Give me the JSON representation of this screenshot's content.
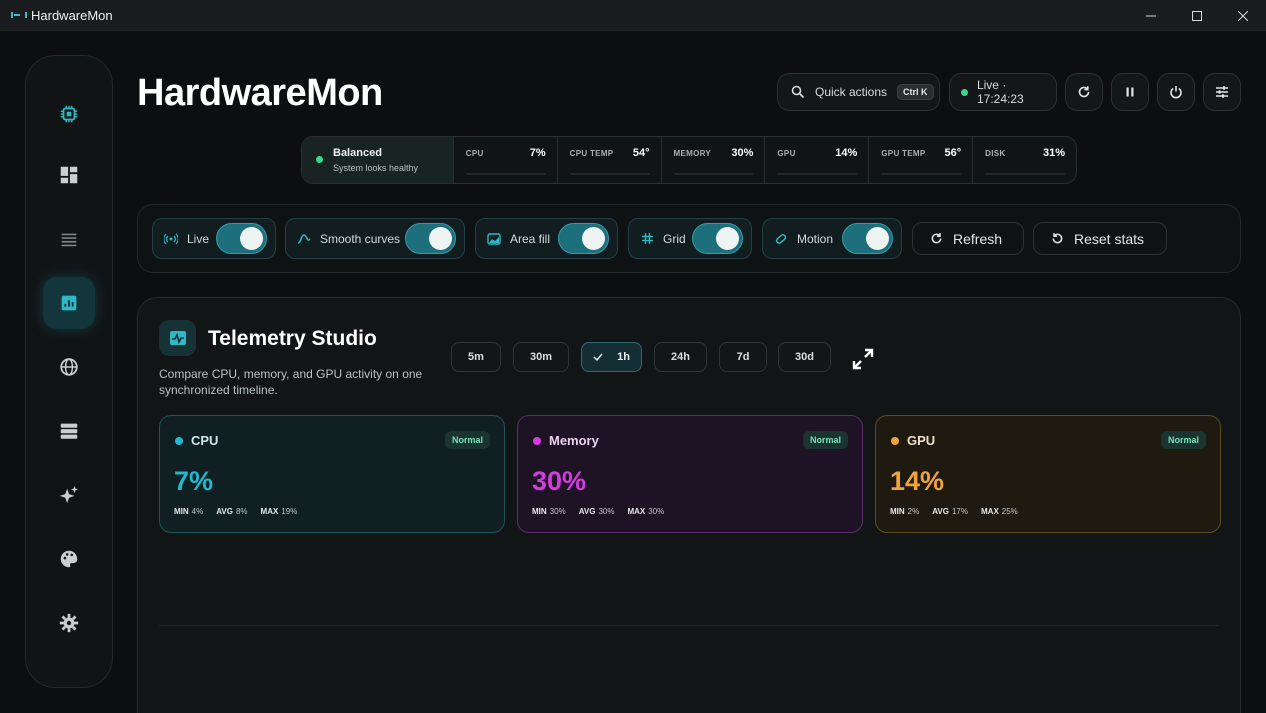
{
  "window": {
    "title": "HardwareMon",
    "minimize": "—",
    "maximize": "☐",
    "close": "✕"
  },
  "header": {
    "brand": "HardwareMon",
    "quick_actions": {
      "label": "Quick actions",
      "shortcut": "Ctrl K"
    },
    "live": {
      "text": "Live · 17:24:23",
      "color": "#3ed68f"
    }
  },
  "sidebar": {
    "items": [
      {
        "name": "chip-icon",
        "active": false
      },
      {
        "name": "dashboard-icon",
        "active": false
      },
      {
        "name": "list-icon",
        "active": false
      },
      {
        "name": "chart-icon",
        "active": true
      },
      {
        "name": "globe-icon",
        "active": false
      },
      {
        "name": "server-icon",
        "active": false
      },
      {
        "name": "sparkles-icon",
        "active": false
      },
      {
        "name": "palette-icon",
        "active": false
      },
      {
        "name": "gear-icon",
        "active": false
      }
    ]
  },
  "status": {
    "health": {
      "title": "Balanced",
      "subtitle": "System looks healthy"
    },
    "metrics": [
      {
        "label": "CPU",
        "value": "7%"
      },
      {
        "label": "CPU TEMP",
        "value": "54°"
      },
      {
        "label": "MEMORY",
        "value": "30%"
      },
      {
        "label": "GPU",
        "value": "14%"
      },
      {
        "label": "GPU TEMP",
        "value": "56°"
      },
      {
        "label": "DISK",
        "value": "31%"
      }
    ]
  },
  "toggles": [
    {
      "label": "Live",
      "on": true
    },
    {
      "label": "Smooth curves",
      "on": true
    },
    {
      "label": "Area fill",
      "on": true
    },
    {
      "label": "Grid",
      "on": true
    },
    {
      "label": "Motion",
      "on": true
    }
  ],
  "actions": {
    "refresh": "Refresh",
    "reset": "Reset stats"
  },
  "studio": {
    "title": "Telemetry Studio",
    "subtitle": "Compare CPU, memory, and GPU activity on one synchronized timeline.",
    "ranges": [
      "5m",
      "30m",
      "1h",
      "24h",
      "7d",
      "30d"
    ],
    "selected_range": "1h",
    "cards": [
      {
        "name": "CPU",
        "status": "Normal",
        "value": "7%",
        "color": "#22b8cf",
        "min": "4%",
        "avg": "8%",
        "max": "19%"
      },
      {
        "name": "Memory",
        "status": "Normal",
        "value": "30%",
        "color": "#d63be0",
        "min": "30%",
        "avg": "30%",
        "max": "30%"
      },
      {
        "name": "GPU",
        "status": "Normal",
        "value": "14%",
        "color": "#f0a33c",
        "min": "2%",
        "avg": "17%",
        "max": "25%"
      }
    ],
    "stat_labels": {
      "min": "MIN",
      "avg": "AVG",
      "max": "MAX"
    }
  }
}
